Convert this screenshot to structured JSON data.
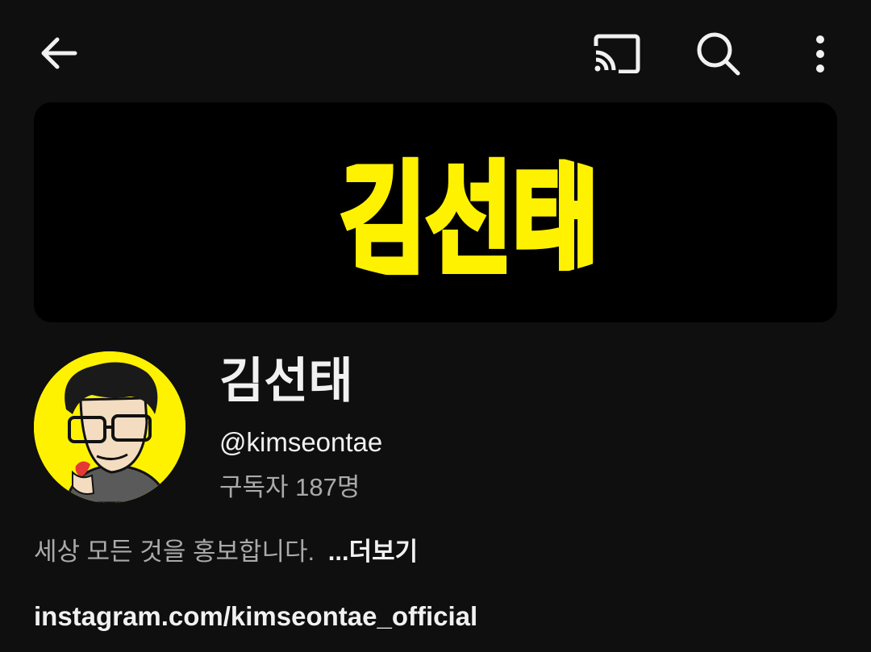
{
  "topbar": {
    "back_icon": "arrow-left-icon",
    "cast_icon": "cast-icon",
    "search_icon": "search-icon",
    "more_icon": "more-vertical-icon"
  },
  "banner": {
    "logo_text": "김선태",
    "logo_color": "#fff200"
  },
  "channel": {
    "name": "김선태",
    "handle": "@kimseontae",
    "subscribers": "구독자 187명",
    "description": "세상 모든 것을 홍보합니다.",
    "more_label": "...더보기",
    "link": "instagram.com/kimseontae_official"
  },
  "colors": {
    "background": "#0f0f0f",
    "primary_text": "#f1f1f1",
    "secondary_text": "#aaaaaa",
    "avatar_bg": "#fff200"
  }
}
